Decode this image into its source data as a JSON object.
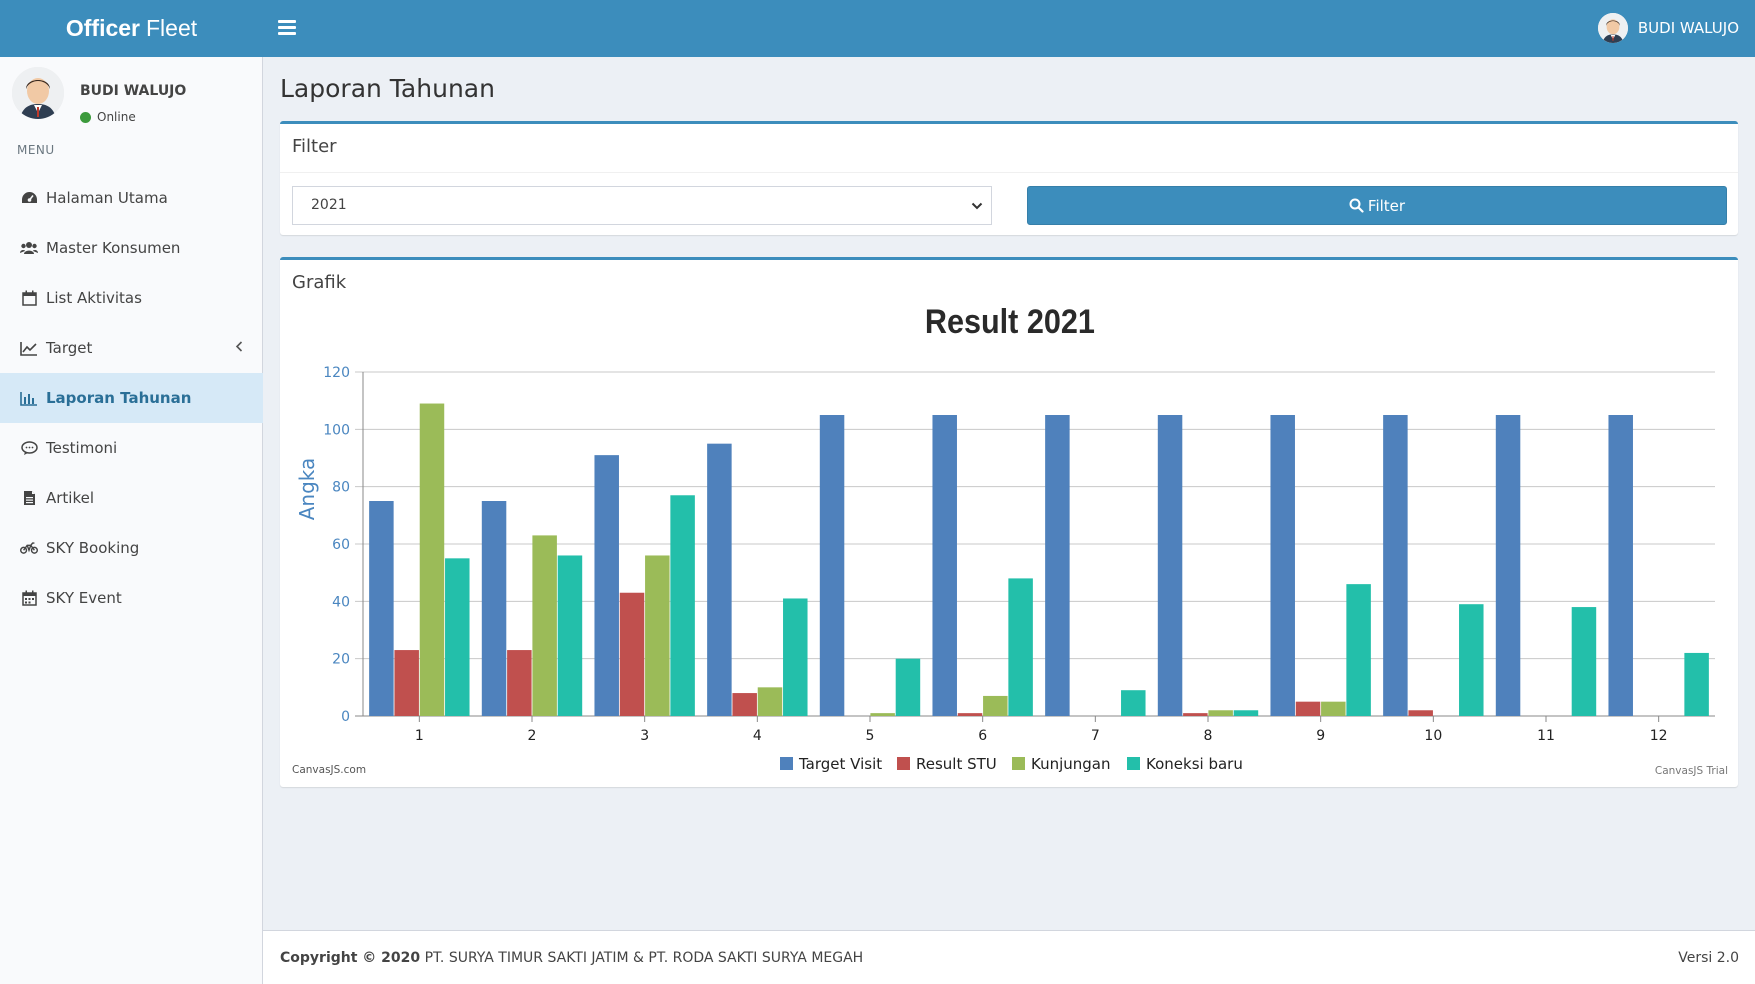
{
  "app": {
    "logo_bold": "Officer",
    "logo_light": "Fleet",
    "user_name": "BUDI WALUJO"
  },
  "sidebar": {
    "user_name": "BUDI WALUJO",
    "status": "Online",
    "menu_header": "MENU",
    "items": [
      {
        "label": "Halaman Utama",
        "icon": "dashboard-icon"
      },
      {
        "label": "Master Konsumen",
        "icon": "users-icon"
      },
      {
        "label": "List Aktivitas",
        "icon": "calendar-icon"
      },
      {
        "label": "Target",
        "icon": "line-chart-icon"
      },
      {
        "label": "Laporan Tahunan",
        "icon": "bar-chart-icon"
      },
      {
        "label": "Testimoni",
        "icon": "comment-icon"
      },
      {
        "label": "Artikel",
        "icon": "file-icon"
      },
      {
        "label": "SKY Booking",
        "icon": "motorcycle-icon"
      },
      {
        "label": "SKY Event",
        "icon": "calendar-grid-icon"
      }
    ]
  },
  "page": {
    "title": "Laporan Tahunan"
  },
  "filter": {
    "title": "Filter",
    "selected_year": "2021",
    "button_label": "Filter"
  },
  "chart_box": {
    "title": "Grafik",
    "credit_left": "CanvasJS.com",
    "credit_right": "CanvasJS Trial"
  },
  "chart_data": {
    "type": "bar",
    "title": "Result 2021",
    "xlabel": "",
    "ylabel": "Angka",
    "ylim": [
      0,
      120
    ],
    "yticks": [
      0,
      20,
      40,
      60,
      80,
      100,
      120
    ],
    "grid": true,
    "legend_position": "bottom",
    "categories": [
      "1",
      "2",
      "3",
      "4",
      "5",
      "6",
      "7",
      "8",
      "9",
      "10",
      "11",
      "12"
    ],
    "series": [
      {
        "name": "Target Visit",
        "color": "#4f81bc",
        "values": [
          75,
          75,
          91,
          95,
          105,
          105,
          105,
          105,
          105,
          105,
          105,
          105
        ]
      },
      {
        "name": "Result STU",
        "color": "#c0504e",
        "values": [
          23,
          23,
          43,
          8,
          0,
          1,
          0,
          1,
          5,
          2,
          0,
          0
        ]
      },
      {
        "name": "Kunjungan",
        "color": "#9bbb58",
        "values": [
          109,
          63,
          56,
          10,
          1,
          7,
          0,
          2,
          5,
          0,
          0,
          0
        ]
      },
      {
        "name": "Koneksi baru",
        "color": "#23bfaa",
        "values": [
          55,
          56,
          77,
          41,
          20,
          48,
          9,
          2,
          46,
          39,
          38,
          22
        ]
      }
    ]
  },
  "footer": {
    "copyright_label": "Copyright © 2020",
    "company": "PT. SURYA TIMUR SAKTI JATIM & PT. RODA SAKTI SURYA MEGAH",
    "version": "Versi 2.0"
  }
}
